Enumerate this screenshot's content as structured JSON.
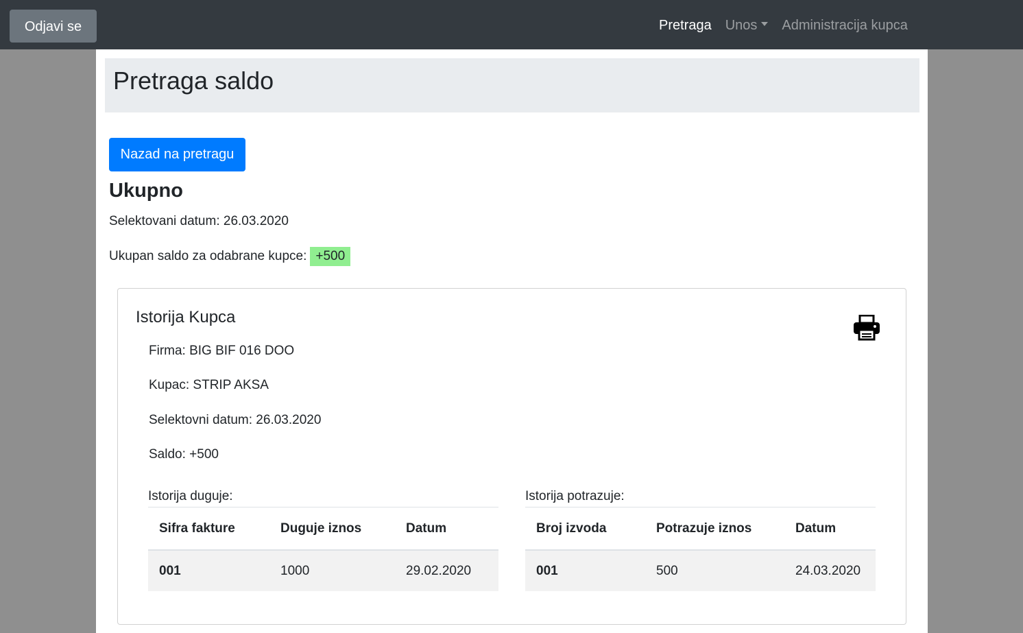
{
  "navbar": {
    "logout_label": "Odjavi se",
    "links": [
      {
        "label": "Pretraga",
        "active": true
      },
      {
        "label": "Unos",
        "dropdown": true
      },
      {
        "label": "Administracija kupca"
      }
    ]
  },
  "header": {
    "title": "Pretraga saldo"
  },
  "actions": {
    "back_label": "Nazad na pretragu"
  },
  "summary": {
    "title": "Ukupno",
    "selected_date": "Selektovani datum: 26.03.2020",
    "total_label": "Ukupan saldo za odabrane kupce:",
    "total_value": "+500",
    "total_color": "#90ee90"
  },
  "card": {
    "title": "Istorija Kupca",
    "print_icon": "print-icon",
    "firma": "Firma: BIG BIF 016 DOO",
    "kupac": "Kupac: STRIP AKSA",
    "datum": "Selektovni datum: 26.03.2020",
    "saldo": "Saldo: +500",
    "duguje": {
      "caption": "Istorija duguje:",
      "headers": [
        "Sifra fakture",
        "Duguje iznos",
        "Datum"
      ],
      "rows": [
        [
          "001",
          "1000",
          "29.02.2020"
        ]
      ]
    },
    "potrazuje": {
      "caption": "Istorija potrazuje:",
      "headers": [
        "Broj izvoda",
        "Potrazuje iznos",
        "Datum"
      ],
      "rows": [
        [
          "001",
          "500",
          "24.03.2020"
        ]
      ]
    }
  },
  "colors": {
    "navbar": "#343a40",
    "primary": "#007bff",
    "secondary": "#6c757d"
  }
}
